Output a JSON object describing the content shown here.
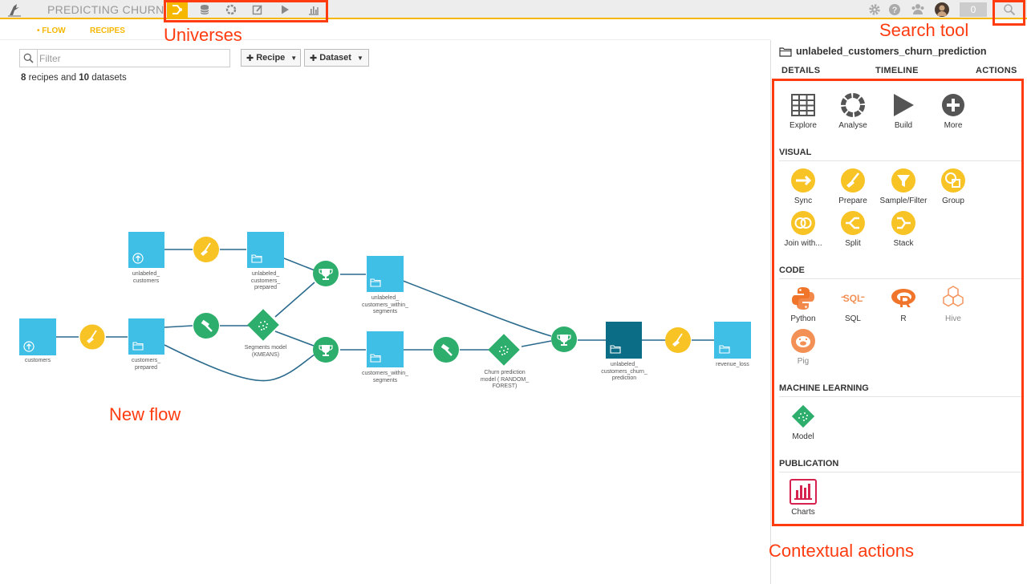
{
  "topbar": {
    "project_title": "PREDICTING CHURN",
    "universe_icons": [
      "flow-icon",
      "datasets-icon",
      "analyses-icon",
      "notebooks-icon",
      "jobs-icon",
      "dashboards-icon"
    ],
    "notification_count": "0",
    "accent_color": "#f5b700"
  },
  "subnav": {
    "flow": "• FLOW",
    "recipes": "RECIPES"
  },
  "toolbar": {
    "filter_placeholder": "Filter",
    "recipe_btn": "Recipe",
    "dataset_btn": "Dataset",
    "count_recipes": "8",
    "count_recipes_suffix": " recipes and ",
    "count_datasets": "10",
    "count_datasets_suffix": " datasets"
  },
  "flow": {
    "labels": {
      "customers": "customers",
      "unlabeled_customers": "unlabeled_\ncustomers",
      "customers_prepared": "customers_\nprepared",
      "unlabeled_customers_prepared": "unlabeled_\ncustomers_\nprepared",
      "segments_model": "Segments model\n(KMEANS)",
      "unlabeled_customers_within_segments": "unlabeled_\ncustomers_within_\nsegments",
      "customers_within_segments": "customers_within_\nsegments",
      "churn_model": "Churn prediction\nmodel ( RANDOM_\nFOREST)",
      "unlabeled_customers_churn_prediction": "unlabeled_\ncustomers_churn_\nprediction",
      "revenue_loss": "revenue_loss"
    },
    "colors": {
      "dataset": "#3fbee6",
      "dataset_selected": "#0c6d86",
      "prepare": "#f7c325",
      "ml": "#2eae6c"
    }
  },
  "annotations": {
    "universes": "Universes",
    "search_tool": "Search tool",
    "new_flow": "New flow",
    "contextual_actions": "Contextual actions"
  },
  "panel": {
    "title": "unlabeled_customers_churn_prediction",
    "tabs": {
      "details": "DETAILS",
      "timeline": "TIMELINE",
      "actions": "ACTIONS"
    },
    "main_actions": [
      "Explore",
      "Analyse",
      "Build",
      "More"
    ],
    "sections": {
      "visual": "VISUAL",
      "code": "CODE",
      "ml": "MACHINE LEARNING",
      "publication": "PUBLICATION"
    },
    "visual": [
      "Sync",
      "Prepare",
      "Sample/Filter",
      "Group",
      "Join with...",
      "Split",
      "Stack"
    ],
    "code": [
      "Python",
      "SQL",
      "R",
      "Hive",
      "Pig"
    ],
    "ml": [
      "Model"
    ],
    "publication": [
      "Charts"
    ]
  }
}
